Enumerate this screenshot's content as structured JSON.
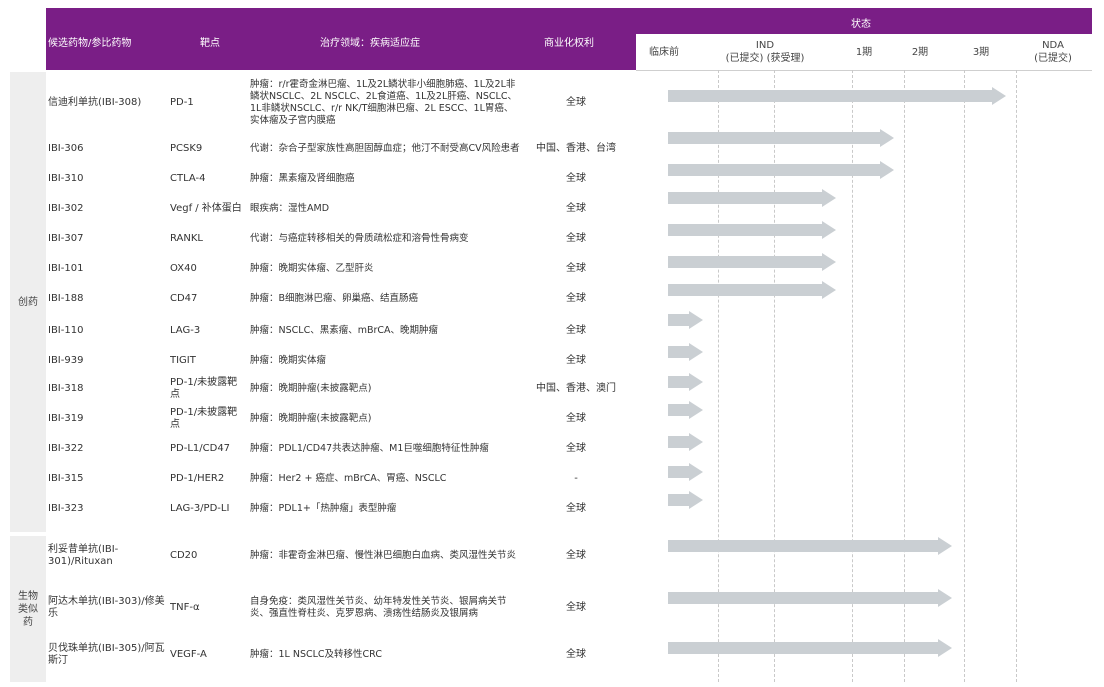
{
  "header": {
    "col_name": "候选药物/参比药物",
    "col_target": "靶点",
    "col_area": "治疗领域：疾病适应症",
    "col_rights": "商业化权利",
    "col_status": "状态",
    "stages": [
      {
        "line1": "临床前",
        "line2": ""
      },
      {
        "line1": "IND",
        "line2": "(已提交)  (获受理)"
      },
      {
        "line1": "1期",
        "line2": ""
      },
      {
        "line1": "2期",
        "line2": ""
      },
      {
        "line1": "3期",
        "line2": ""
      },
      {
        "line1": "NDA",
        "line2": "(已提交)"
      }
    ]
  },
  "groups": [
    {
      "label": "创药"
    },
    {
      "label": "生物类似药"
    }
  ],
  "rows": [
    {
      "name": "信迪利单抗(IBI-308)",
      "target": "PD-1",
      "area": "肿瘤：r/r霍奇金淋巴瘤、1L及2L鳞状非小细胞肺癌、1L及2L非鳞状NSCLC、2L NSCLC、2L食道癌、1L及2L肝癌、NSCLC、1L非鳞状NSCLC、r/r NK/T细胞淋巴瘤、2L ESCC、1L胃癌、实体瘤及子宫内膜癌",
      "rights": "全球",
      "stage_reached": 5.8
    },
    {
      "name": "IBI-306",
      "target": "PCSK9",
      "area": "代谢：杂合子型家族性高胆固醇血症；他汀不耐受高CV风险患者",
      "rights": "中国、香港、台湾",
      "stage_reached": 3.8
    },
    {
      "name": "IBI-310",
      "target": "CTLA-4",
      "area": "肿瘤：黑素瘤及肾细胞癌",
      "rights": "全球",
      "stage_reached": 3.8
    },
    {
      "name": "IBI-302",
      "target": "Vegf / 补体蛋白",
      "area": "眼疾病：湿性AMD",
      "rights": "全球",
      "stage_reached": 2.8
    },
    {
      "name": "IBI-307",
      "target": "RANKL",
      "area": "代谢：与癌症转移相关的骨质疏松症和溶骨性骨病变",
      "rights": "全球",
      "stage_reached": 2.8
    },
    {
      "name": "IBI-101",
      "target": "OX40",
      "area": "肿瘤：晚期实体瘤、乙型肝炎",
      "rights": "全球",
      "stage_reached": 2.8
    },
    {
      "name": "IBI-188",
      "target": "CD47",
      "area": "肿瘤：B细胞淋巴瘤、卵巢癌、结直肠癌",
      "rights": "全球",
      "stage_reached": 2.8
    },
    {
      "name": "IBI-110",
      "target": "LAG-3",
      "area": "肿瘤：NSCLC、黑素瘤、mBrCA、晚期肿瘤",
      "rights": "全球",
      "stage_reached": 0.7
    },
    {
      "name": "IBI-939",
      "target": "TIGIT",
      "area": "肿瘤：晚期实体瘤",
      "rights": "全球",
      "stage_reached": 0.7
    },
    {
      "name": "IBI-318",
      "target": "PD-1/未披露靶点",
      "area": "肿瘤：晚期肿瘤(未披露靶点)",
      "rights": "中国、香港、澳门",
      "stage_reached": 0.7
    },
    {
      "name": "IBI-319",
      "target": "PD-1/未披露靶点",
      "area": "肿瘤：晚期肿瘤(未披露靶点)",
      "rights": "全球",
      "stage_reached": 0.7
    },
    {
      "name": "IBI-322",
      "target": "PD-L1/CD47",
      "area": "肿瘤：PDL1/CD47共表达肿瘤、M1巨噬细胞特征性肿瘤",
      "rights": "全球",
      "stage_reached": 0.7
    },
    {
      "name": "IBI-315",
      "target": "PD-1/HER2",
      "area": "肿瘤：Her2 + 癌症、mBrCA、胃癌、NSCLC",
      "rights": "-",
      "stage_reached": 0.7
    },
    {
      "name": "IBI-323",
      "target": "LAG-3/PD-LI",
      "area": "肿瘤：PDL1+「热肿瘤」表型肿瘤",
      "rights": "全球",
      "stage_reached": 0.7
    },
    {
      "name": "利妥昔单抗(IBI-301)/Rituxan",
      "target": "CD20",
      "area": "肿瘤：非霍奇金淋巴瘤、慢性淋巴细胞白血病、类风湿性关节炎",
      "rights": "全球",
      "stage_reached": 4.8
    },
    {
      "name": "阿达木单抗(IBI-303)/修美乐",
      "target": "TNF-α",
      "area": "自身免疫：类风湿性关节炎、幼年特发性关节炎、银屑病关节炎、强直性脊柱炎、克罗恩病、溃疡性结肠炎及银屑病",
      "rights": "全球",
      "stage_reached": 4.8
    },
    {
      "name": "贝伐珠单抗(IBI-305)/阿瓦斯汀",
      "target": "VEGF-A",
      "area": "肿瘤：1L NSCLC及转移性CRC",
      "rights": "全球",
      "stage_reached": 4.8
    }
  ]
}
